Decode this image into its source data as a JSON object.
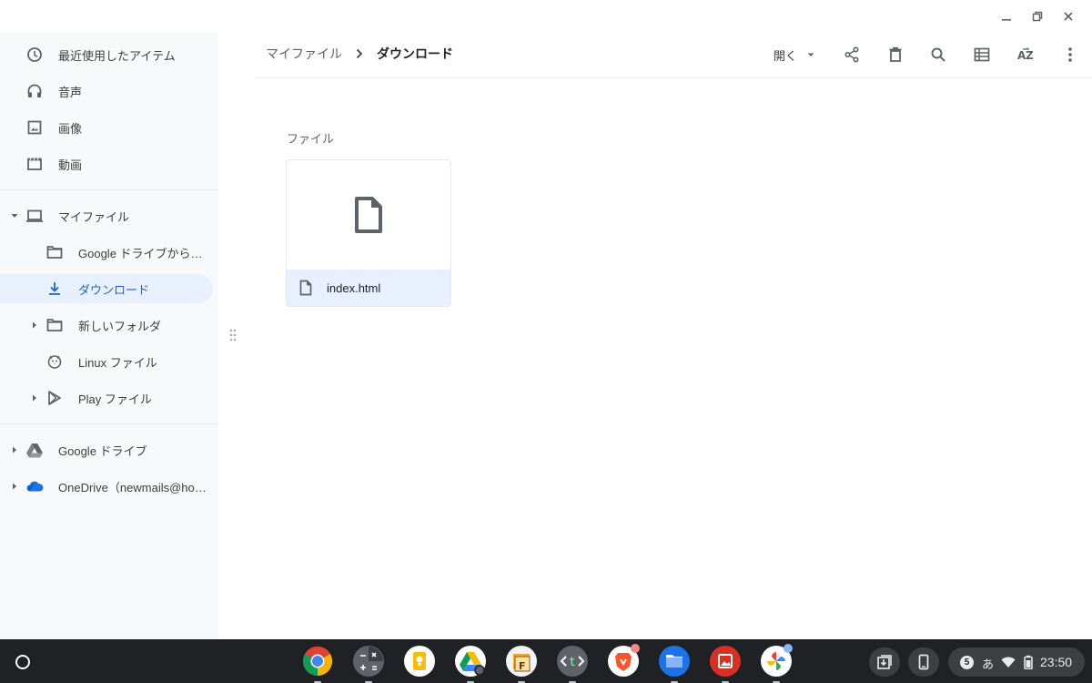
{
  "sidebar": {
    "recent": "最近使用したアイテム",
    "audio": "音声",
    "images": "画像",
    "videos": "動画",
    "my_files": "マイファイル",
    "google_drive_from": "Google ドライブから…",
    "downloads": "ダウンロード",
    "new_folder": "新しいフォルダ",
    "linux_files": "Linux ファイル",
    "play_files": "Play ファイル",
    "google_drive": "Google ドライブ",
    "onedrive": "OneDrive（newmails@ho…"
  },
  "breadcrumb": {
    "root": "マイファイル",
    "current": "ダウンロード"
  },
  "toolbar": {
    "open_label": "開く"
  },
  "content": {
    "section_label": "ファイル",
    "files": [
      {
        "name": "index.html"
      }
    ]
  },
  "shelf": {
    "apps": [
      "chrome",
      "calculator",
      "keep",
      "google-drive",
      "files-app-f",
      "text",
      "brave",
      "files",
      "gallery",
      "photos"
    ],
    "notification_count": "5",
    "ime": "あ",
    "time": "23:50"
  },
  "colors": {
    "accent": "#1967d2",
    "active_bg": "#e8f0fe",
    "shelf_bg": "#202124"
  }
}
